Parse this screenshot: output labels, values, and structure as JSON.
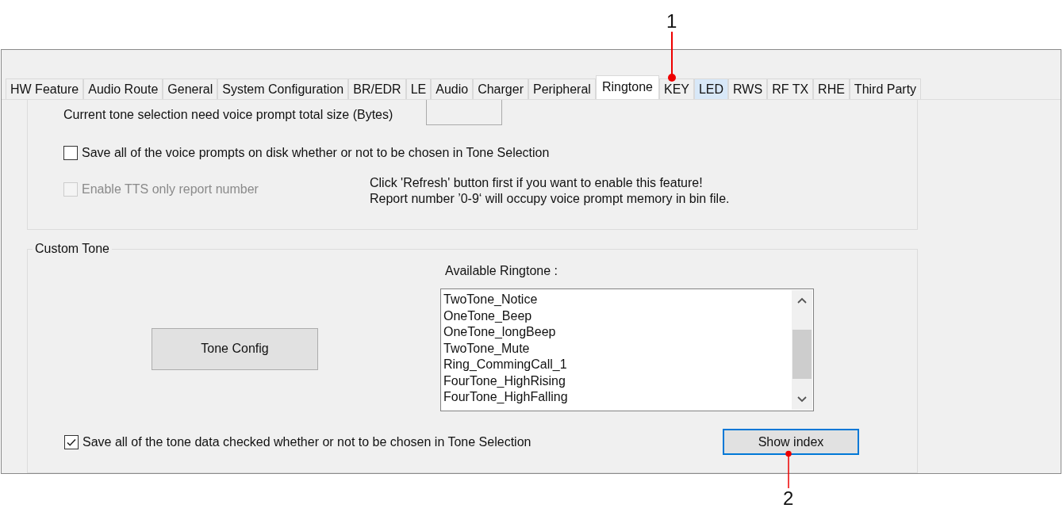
{
  "callouts": [
    {
      "label": "1"
    },
    {
      "label": "2"
    }
  ],
  "tabs": [
    {
      "label": "HW Feature",
      "selected": false,
      "highlighted": false
    },
    {
      "label": "Audio Route",
      "selected": false,
      "highlighted": false
    },
    {
      "label": "General",
      "selected": false,
      "highlighted": false
    },
    {
      "label": "System Configuration",
      "selected": false,
      "highlighted": false
    },
    {
      "label": "BR/EDR",
      "selected": false,
      "highlighted": false
    },
    {
      "label": "LE",
      "selected": false,
      "highlighted": false
    },
    {
      "label": "Audio",
      "selected": false,
      "highlighted": false
    },
    {
      "label": "Charger",
      "selected": false,
      "highlighted": false
    },
    {
      "label": "Peripheral",
      "selected": false,
      "highlighted": false
    },
    {
      "label": "Ringtone",
      "selected": true,
      "highlighted": false
    },
    {
      "label": "KEY",
      "selected": false,
      "highlighted": false
    },
    {
      "label": "LED",
      "selected": false,
      "highlighted": true
    },
    {
      "label": "RWS",
      "selected": false,
      "highlighted": false
    },
    {
      "label": "RF TX",
      "selected": false,
      "highlighted": false
    },
    {
      "label": "RHE",
      "selected": false,
      "highlighted": false
    },
    {
      "label": "Third Party",
      "selected": false,
      "highlighted": false
    }
  ],
  "voice_prompt": {
    "size_label": "Current tone selection need voice prompt total size (Bytes)",
    "save_all": {
      "label": "Save all of the voice prompts on disk whether or not to be chosen in Tone Selection",
      "checked": false,
      "disabled": false
    },
    "enable_tts": {
      "label": "Enable TTS only report number",
      "checked": false,
      "disabled": true
    },
    "tts_note": [
      "Click 'Refresh' button first if you want to enable this feature!",
      "Report number ’0-9‘ will occupy voice prompt  memory in bin file."
    ]
  },
  "custom_tone": {
    "title": "Custom Tone",
    "tone_config_button": "Tone Config",
    "ringtone_label": "Available Ringtone :",
    "ringtones": [
      "TwoTone_Notice",
      "OneTone_Beep",
      "OneTone_longBeep",
      "TwoTone_Mute",
      "Ring_CommingCall_1",
      "FourTone_HighRising",
      "FourTone_HighFalling"
    ],
    "save_tone_data": {
      "label": "Save all of the tone data checked whether or not to be chosen in Tone Selection",
      "checked": true,
      "disabled": false
    },
    "show_index_button": {
      "label": "Show index",
      "focused": true
    }
  }
}
